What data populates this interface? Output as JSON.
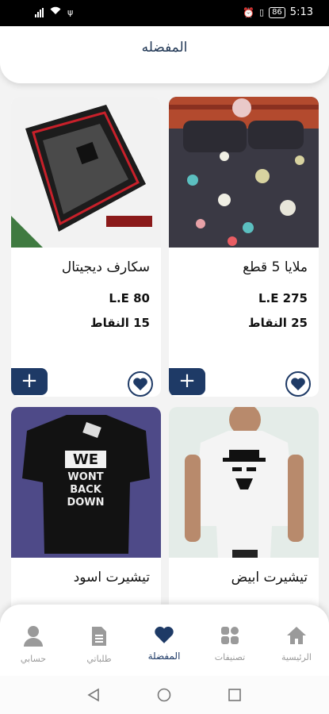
{
  "status_bar": {
    "time": "5:13",
    "battery": "86",
    "icons": [
      "signal-icon",
      "wifi-icon",
      "usb-icon",
      "alarm-icon",
      "vibrate-icon",
      "battery-icon"
    ]
  },
  "header": {
    "title": "المفضله"
  },
  "products": [
    {
      "name": "ملايا 5 قطع",
      "price": "L.E 275",
      "points": "25 النقاط"
    },
    {
      "name": "سكارف ديجيتال",
      "price": "L.E 80",
      "points": "15 النقاط"
    },
    {
      "name": "تيشيرت ابيض",
      "price": "",
      "points": ""
    },
    {
      "name": "تيشيرت اسود",
      "price": "",
      "points": ""
    }
  ],
  "tshirt_text": {
    "line1": "WE",
    "line2": "WONT",
    "line3": "BACK",
    "line4": "DOWN"
  },
  "bottom_nav": {
    "items": [
      {
        "label": "الرئيسية",
        "icon": "home-icon"
      },
      {
        "label": "تصنيفات",
        "icon": "categories-icon"
      },
      {
        "label": "المفضلة",
        "icon": "heart-icon",
        "active": true
      },
      {
        "label": "طلباتي",
        "icon": "orders-icon"
      },
      {
        "label": "حسابي",
        "icon": "account-icon"
      }
    ]
  },
  "colors": {
    "accent": "#1e3a66",
    "title": "#1e3553",
    "background": "#f3f3f3"
  }
}
